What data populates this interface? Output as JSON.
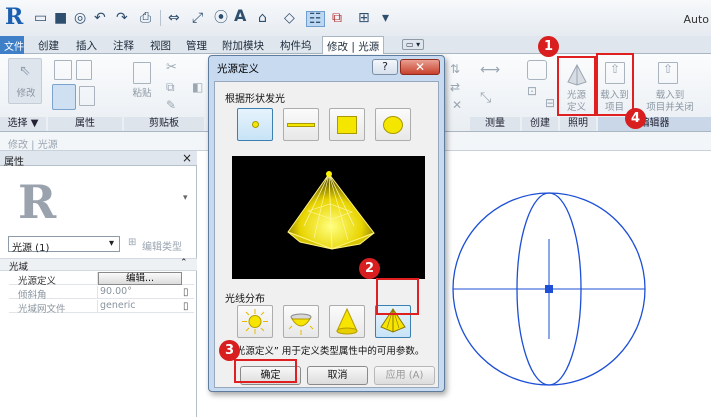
{
  "app": {
    "title": "Auto",
    "logo": "R"
  },
  "ribbon_tabs": [
    "文件",
    "创建",
    "插入",
    "注释",
    "视图",
    "管理",
    "附加模块",
    "构件坞",
    "修改 | 光源"
  ],
  "ribbon_panels": {
    "select": "选择 ▼",
    "properties": "属性",
    "clipboard": "剪贴板",
    "measure": "测量",
    "create": "创建",
    "lighting": "照明",
    "editor": "编辑器"
  },
  "ribbon_buttons": {
    "modify": "修改",
    "paste": "粘贴",
    "light_source_def_line1": "光源",
    "light_source_def_line2": "定义",
    "load_into_project_line1": "载入到",
    "load_into_project_line2": "项目",
    "load_close_line1": "载入到",
    "load_close_line2": "项目并关闭"
  },
  "context_bar": "修改 | 光源",
  "properties": {
    "header": "属性",
    "close": "×",
    "type_selector": "光源 (1)",
    "edit_type": "编辑类型",
    "group": "光域",
    "rows": [
      {
        "name": "光源定义",
        "value": "编辑..."
      },
      {
        "name": "倾斜角",
        "value": "90.00°"
      },
      {
        "name": "光域网文件",
        "value": "generic"
      }
    ]
  },
  "dialog": {
    "title": "光源定义",
    "help": "?",
    "close": "✕",
    "shape_label": "根据形状发光",
    "dist_label": "光线分布",
    "info": "“光源定义” 用于定义类型属性中的可用参数。",
    "ok": "确定",
    "cancel": "取消",
    "apply": "应用 (A)",
    "shapes": [
      "point",
      "line",
      "rectangle",
      "circle"
    ],
    "selected_shape": "point",
    "distributions": [
      "spherical",
      "hemispherical",
      "spot",
      "photometric-web"
    ],
    "selected_distribution": "photometric-web"
  },
  "callouts": [
    "1",
    "2",
    "3",
    "4"
  ],
  "colors": {
    "accent_red": "#d81e1e",
    "light_yellow": "#f5e600",
    "plan_blue": "#1d4fd6"
  }
}
